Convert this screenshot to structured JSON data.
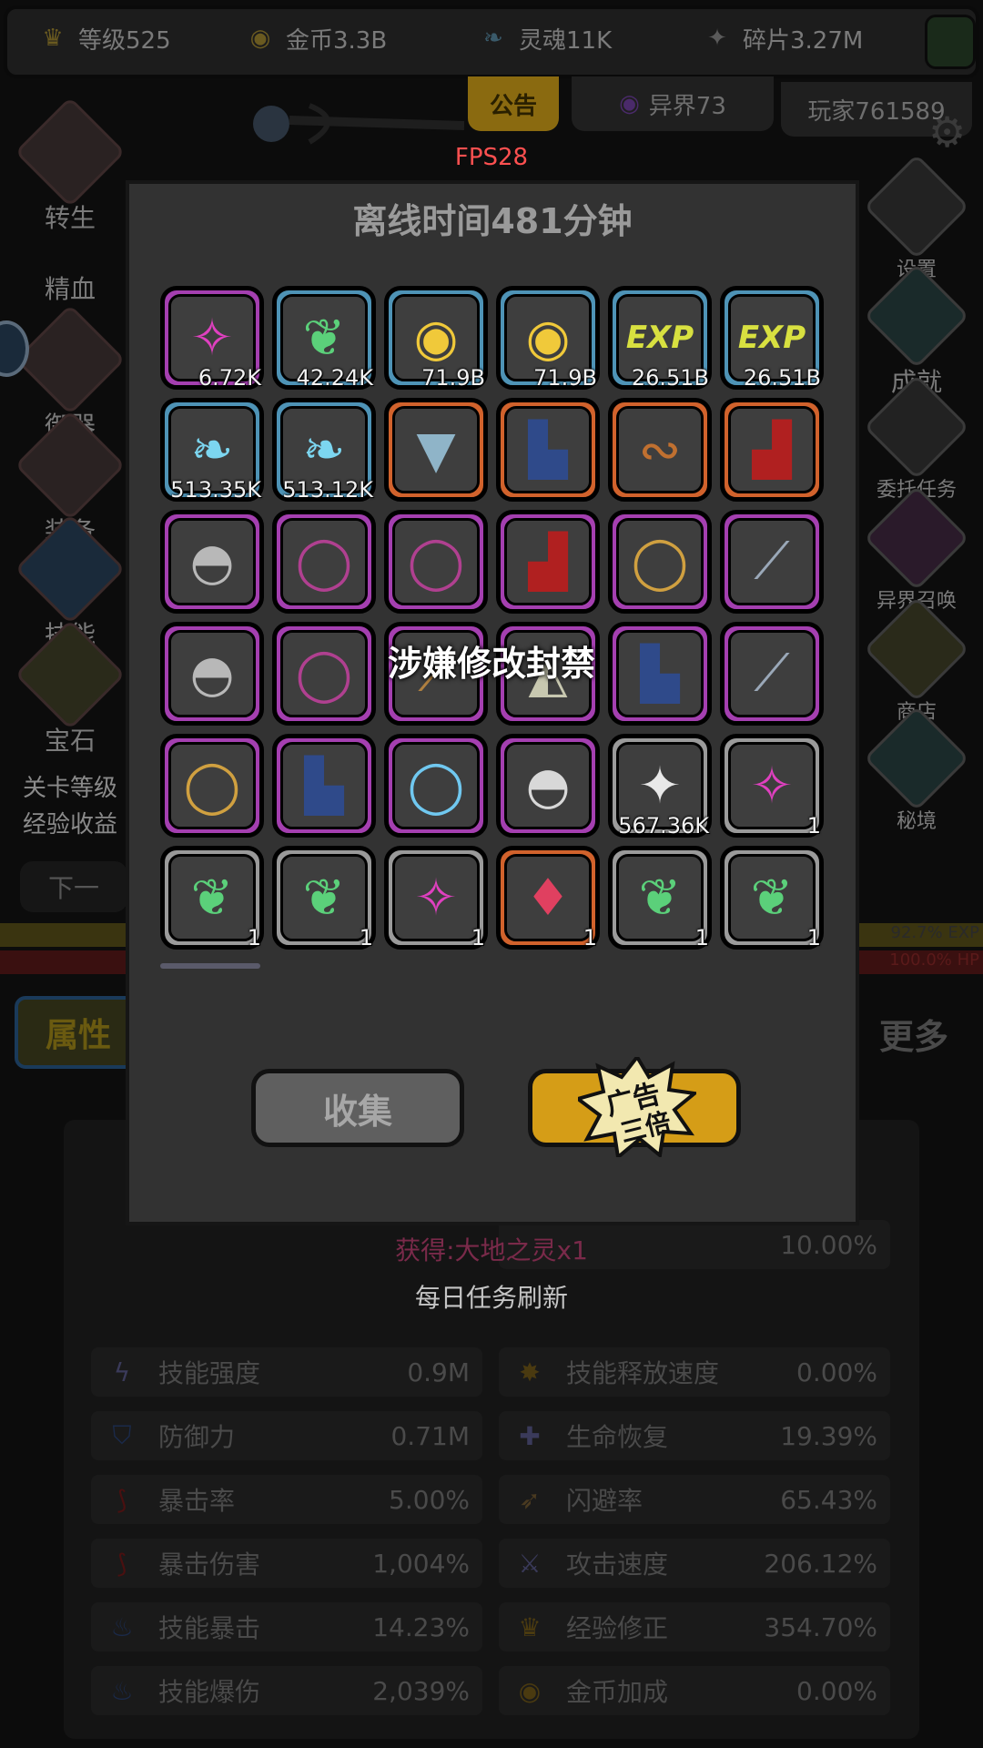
{
  "topbar": {
    "level": "等级525",
    "gold": "金币3.3B",
    "soul": "灵魂11K",
    "shard": "碎片3.27M"
  },
  "tabs": {
    "notice": "公告",
    "otherworld": "异界73",
    "player": "玩家761589"
  },
  "fps": "FPS28",
  "left_menu": [
    {
      "label": "转生",
      "icon": "rebirth-icon"
    },
    {
      "label": "精血",
      "icon": "blood-icon"
    },
    {
      "label": "御器",
      "icon": "weapon-icon"
    },
    {
      "label": "装备",
      "icon": "equipment-icon"
    },
    {
      "label": "技能",
      "icon": "skill-icon"
    },
    {
      "label": "宝石",
      "icon": "gem-icon"
    }
  ],
  "left_info": {
    "line1": "关卡等级",
    "line2": "经验收益",
    "next": "下一"
  },
  "right_menu": [
    {
      "label": "设置",
      "icon": "settings-icon"
    },
    {
      "label": "成就",
      "icon": "achievement-icon"
    },
    {
      "label": "委托任务",
      "icon": "commission-icon"
    },
    {
      "label": "异界召唤",
      "icon": "summon-icon"
    },
    {
      "label": "商店",
      "icon": "shop-icon"
    },
    {
      "label": "秘境",
      "icon": "secret-realm-icon"
    }
  ],
  "bars": {
    "exp": "92.7% EXP",
    "hp": "100.0% HP"
  },
  "bottom_tabs": {
    "attributes": "属性",
    "more": "更多"
  },
  "stats": [
    {
      "name": "",
      "value": "10.00%",
      "col": "right"
    },
    {
      "name": "技能强度",
      "value": "0.9M",
      "col": "left"
    },
    {
      "name": "技能释放速度",
      "value": "0.00%",
      "col": "right"
    },
    {
      "name": "防御力",
      "value": "0.71M",
      "col": "left"
    },
    {
      "name": "生命恢复",
      "value": "19.39%",
      "col": "right"
    },
    {
      "name": "暴击率",
      "value": "5.00%",
      "col": "left"
    },
    {
      "name": "闪避率",
      "value": "65.43%",
      "col": "right"
    },
    {
      "name": "暴击伤害",
      "value": "1,004%",
      "col": "left"
    },
    {
      "name": "攻击速度",
      "value": "206.12%",
      "col": "right"
    },
    {
      "name": "技能暴击",
      "value": "14.23%",
      "col": "left"
    },
    {
      "name": "经验修正",
      "value": "354.70%",
      "col": "right"
    },
    {
      "name": "技能爆伤",
      "value": "2,039%",
      "col": "left"
    },
    {
      "name": "金币加成",
      "value": "0.00%",
      "col": "right"
    }
  ],
  "dialog": {
    "title": "离线时间481分钟",
    "collect": "收集",
    "ad_line1": "广告",
    "ad_line2": "三倍"
  },
  "items": [
    {
      "q": "purple",
      "icon": "pink-feather-icon",
      "glyph": "✧",
      "color": "#e040c0",
      "count": "6.72K"
    },
    {
      "q": "blue",
      "icon": "green-spirit-icon",
      "glyph": "❦",
      "color": "#5bd07a",
      "count": "42.24K"
    },
    {
      "q": "blue",
      "icon": "gold-coin-icon",
      "glyph": "◉",
      "color": "#f0c93a",
      "count": "71.9B"
    },
    {
      "q": "blue",
      "icon": "gold-coin-icon",
      "glyph": "◉",
      "color": "#f0c93a",
      "count": "71.9B"
    },
    {
      "q": "blue",
      "icon": "exp-icon",
      "glyph": "EXP",
      "color": "#d8e040",
      "count": "26.51B"
    },
    {
      "q": "blue",
      "icon": "exp-icon",
      "glyph": "EXP",
      "color": "#d8e040",
      "count": "26.51B"
    },
    {
      "q": "blue",
      "icon": "blue-soul-icon",
      "glyph": "❧",
      "color": "#7cd6f0",
      "count": "513.35K"
    },
    {
      "q": "blue",
      "icon": "blue-soul-icon",
      "glyph": "❧",
      "color": "#7cd6f0",
      "count": "513.12K"
    },
    {
      "q": "orange",
      "icon": "armor-icon",
      "glyph": "▼",
      "color": "#8fb4c8",
      "count": ""
    },
    {
      "q": "orange",
      "icon": "boot-icon",
      "glyph": "▙",
      "color": "#2f4a8a",
      "count": ""
    },
    {
      "q": "orange",
      "icon": "necklace-icon",
      "glyph": "∾",
      "color": "#c07030",
      "count": ""
    },
    {
      "q": "orange",
      "icon": "red-shoe-icon",
      "glyph": "▟",
      "color": "#b02020",
      "count": ""
    },
    {
      "q": "purple",
      "icon": "helmet-icon",
      "glyph": "◓",
      "color": "#b8b8b8",
      "count": ""
    },
    {
      "q": "purple",
      "icon": "necklace-icon",
      "glyph": "◯",
      "color": "#b04090",
      "count": ""
    },
    {
      "q": "purple",
      "icon": "necklace-icon",
      "glyph": "◯",
      "color": "#b04090",
      "count": ""
    },
    {
      "q": "purple",
      "icon": "red-shoe-icon",
      "glyph": "▟",
      "color": "#b02020",
      "count": ""
    },
    {
      "q": "purple",
      "icon": "ring-icon",
      "glyph": "◯",
      "color": "#d0a040",
      "count": ""
    },
    {
      "q": "purple",
      "icon": "sword-icon",
      "glyph": "⟋",
      "color": "#9aa8b8",
      "count": ""
    },
    {
      "q": "purple",
      "icon": "helmet-icon",
      "glyph": "◓",
      "color": "#b8b8b8",
      "count": ""
    },
    {
      "q": "purple",
      "icon": "necklace-icon",
      "glyph": "◯",
      "color": "#b04090",
      "count": ""
    },
    {
      "q": "purple",
      "icon": "staff-icon",
      "glyph": "⟋",
      "color": "#b08040",
      "count": ""
    },
    {
      "q": "purple",
      "icon": "fan-icon",
      "glyph": "◭",
      "color": "#c8c8b0",
      "count": ""
    },
    {
      "q": "purple",
      "icon": "boot-icon",
      "glyph": "▙",
      "color": "#2f4a8a",
      "count": ""
    },
    {
      "q": "purple",
      "icon": "sword-icon",
      "glyph": "⟋",
      "color": "#9aa8b8",
      "count": ""
    },
    {
      "q": "purple",
      "icon": "ring-icon",
      "glyph": "◯",
      "color": "#d0a040",
      "count": ""
    },
    {
      "q": "purple",
      "icon": "boot-icon",
      "glyph": "▙",
      "color": "#2f4a8a",
      "count": ""
    },
    {
      "q": "purple",
      "icon": "bracelet-icon",
      "glyph": "◯",
      "color": "#70c8f0",
      "count": ""
    },
    {
      "q": "purple",
      "icon": "hat-icon",
      "glyph": "◓",
      "color": "#d8d8d8",
      "count": ""
    },
    {
      "q": "gray",
      "icon": "white-shard-icon",
      "glyph": "✦",
      "color": "#e8e8e8",
      "count": "567.36K"
    },
    {
      "q": "gray",
      "icon": "pink-feather-icon",
      "glyph": "✧",
      "color": "#e040c0",
      "count": "1"
    },
    {
      "q": "gray",
      "icon": "green-spirit-icon",
      "glyph": "❦",
      "color": "#5bd07a",
      "count": "1"
    },
    {
      "q": "gray",
      "icon": "green-spirit-icon",
      "glyph": "❦",
      "color": "#5bd07a",
      "count": "1"
    },
    {
      "q": "gray",
      "icon": "pink-feather-icon",
      "glyph": "✧",
      "color": "#e040c0",
      "count": "1"
    },
    {
      "q": "orange",
      "icon": "red-crystal-icon",
      "glyph": "♦",
      "color": "#e04060",
      "count": "1"
    },
    {
      "q": "gray",
      "icon": "green-spirit-icon",
      "glyph": "❦",
      "color": "#5bd07a",
      "count": "1"
    },
    {
      "q": "gray",
      "icon": "green-spirit-icon",
      "glyph": "❦",
      "color": "#5bd07a",
      "count": "1"
    }
  ],
  "toasts": {
    "ban": "涉嫌修改封禁",
    "got": "获得:大地之灵x1",
    "daily": "每日任务刷新"
  }
}
